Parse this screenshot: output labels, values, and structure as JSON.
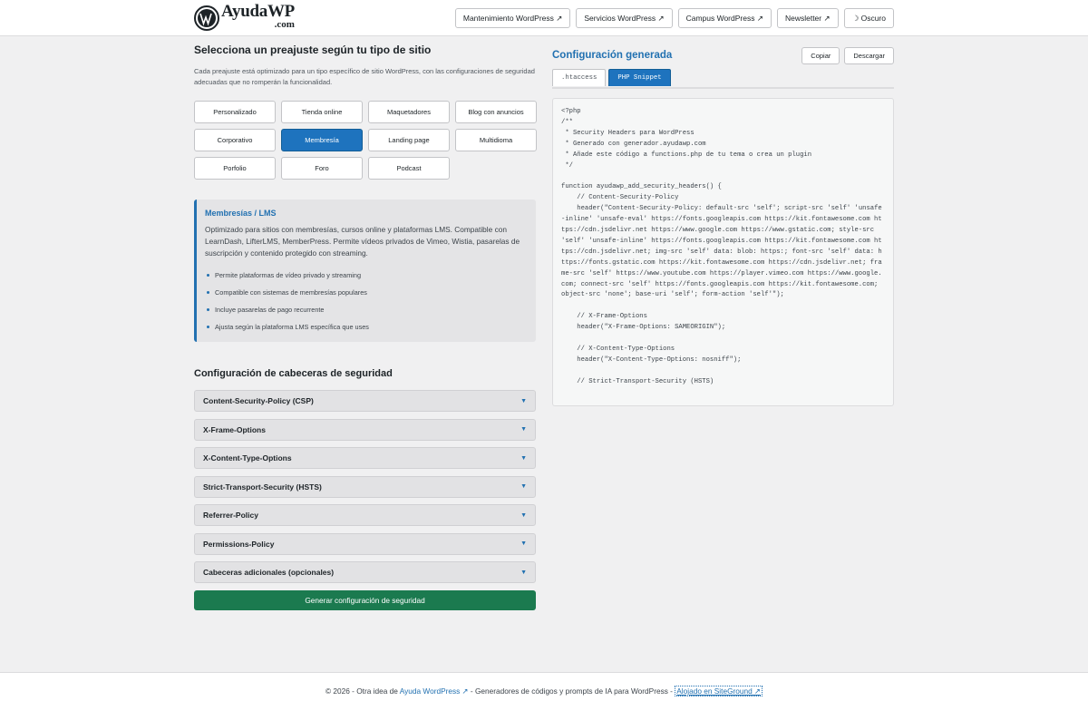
{
  "header": {
    "logo_name": "AyudaWP",
    "logo_tld": ".com",
    "nav": [
      "Mantenimiento WordPress ↗",
      "Servicios WordPress ↗",
      "Campus WordPress ↗",
      "Newsletter ↗",
      "☽ Oscuro"
    ]
  },
  "left": {
    "title": "Selecciona un preajuste según tu tipo de sitio",
    "description": "Cada preajuste está optimizado para un tipo específico de sitio WordPress, con las configuraciones de seguridad adecuadas que no romperán la funcionalidad.",
    "presets": [
      "Personalizado",
      "Tienda online",
      "Maquetadores",
      "Blog con anuncios",
      "Corporativo",
      "Membresía",
      "Landing page",
      "Multidioma",
      "Porfolio",
      "Foro",
      "Podcast"
    ],
    "active_preset": "Membresía",
    "info": {
      "title": "Membresías / LMS",
      "description": "Optimizado para sitios con membresías, cursos online y plataformas LMS. Compatible con LearnDash, LifterLMS, MemberPress. Permite vídeos privados de Vimeo, Wistia, pasarelas de suscripción y contenido protegido con streaming.",
      "bullets": [
        "Permite plataformas de vídeo privado y streaming",
        "Compatible con sistemas de membresías populares",
        "Incluye pasarelas de pago recurrente",
        "Ajusta según la plataforma LMS específica que uses"
      ]
    },
    "headers_title": "Configuración de cabeceras de seguridad",
    "headers": [
      "Content-Security-Policy (CSP)",
      "X-Frame-Options",
      "X-Content-Type-Options",
      "Strict-Transport-Security (HSTS)",
      "Referrer-Policy",
      "Permissions-Policy",
      "Cabeceras adicionales (opcionales)"
    ],
    "generate_label": "Generar configuración de seguridad"
  },
  "right": {
    "title": "Configuración generada",
    "copy_label": "Copiar",
    "download_label": "Descargar",
    "tabs": [
      ".htaccess",
      "PHP Snippet"
    ],
    "active_tab": "PHP Snippet",
    "code": "<?php\n/**\n * Security Headers para WordPress\n * Generado con generador.ayudawp.com\n * Añade este código a functions.php de tu tema o crea un plugin\n */\n\nfunction ayudawp_add_security_headers() {\n    // Content-Security-Policy\n    header(\"Content-Security-Policy: default-src 'self'; script-src 'self' 'unsafe-inline' 'unsafe-eval' https://fonts.googleapis.com https://kit.fontawesome.com https://cdn.jsdelivr.net https://www.google.com https://www.gstatic.com; style-src 'self' 'unsafe-inline' https://fonts.googleapis.com https://kit.fontawesome.com https://cdn.jsdelivr.net; img-src 'self' data: blob: https:; font-src 'self' data: https://fonts.gstatic.com https://kit.fontawesome.com https://cdn.jsdelivr.net; frame-src 'self' https://www.youtube.com https://player.vimeo.com https://www.google.com; connect-src 'self' https://fonts.googleapis.com https://kit.fontawesome.com; object-src 'none'; base-uri 'self'; form-action 'self'\");\n\n    // X-Frame-Options\n    header(\"X-Frame-Options: SAMEORIGIN\");\n\n    // X-Content-Type-Options\n    header(\"X-Content-Type-Options: nosniff\");\n\n    // Strict-Transport-Security (HSTS)"
  },
  "footer": {
    "prefix": "© 2026 - Otra idea de ",
    "link": "Ayuda WordPress ↗",
    "middle": " - Generadores de códigos y prompts de IA para WordPress - ",
    "hosted": "Alojado en SiteGround ↗"
  },
  "colors": {
    "accent": "#1e73be",
    "generate": "#1b7a4f"
  }
}
